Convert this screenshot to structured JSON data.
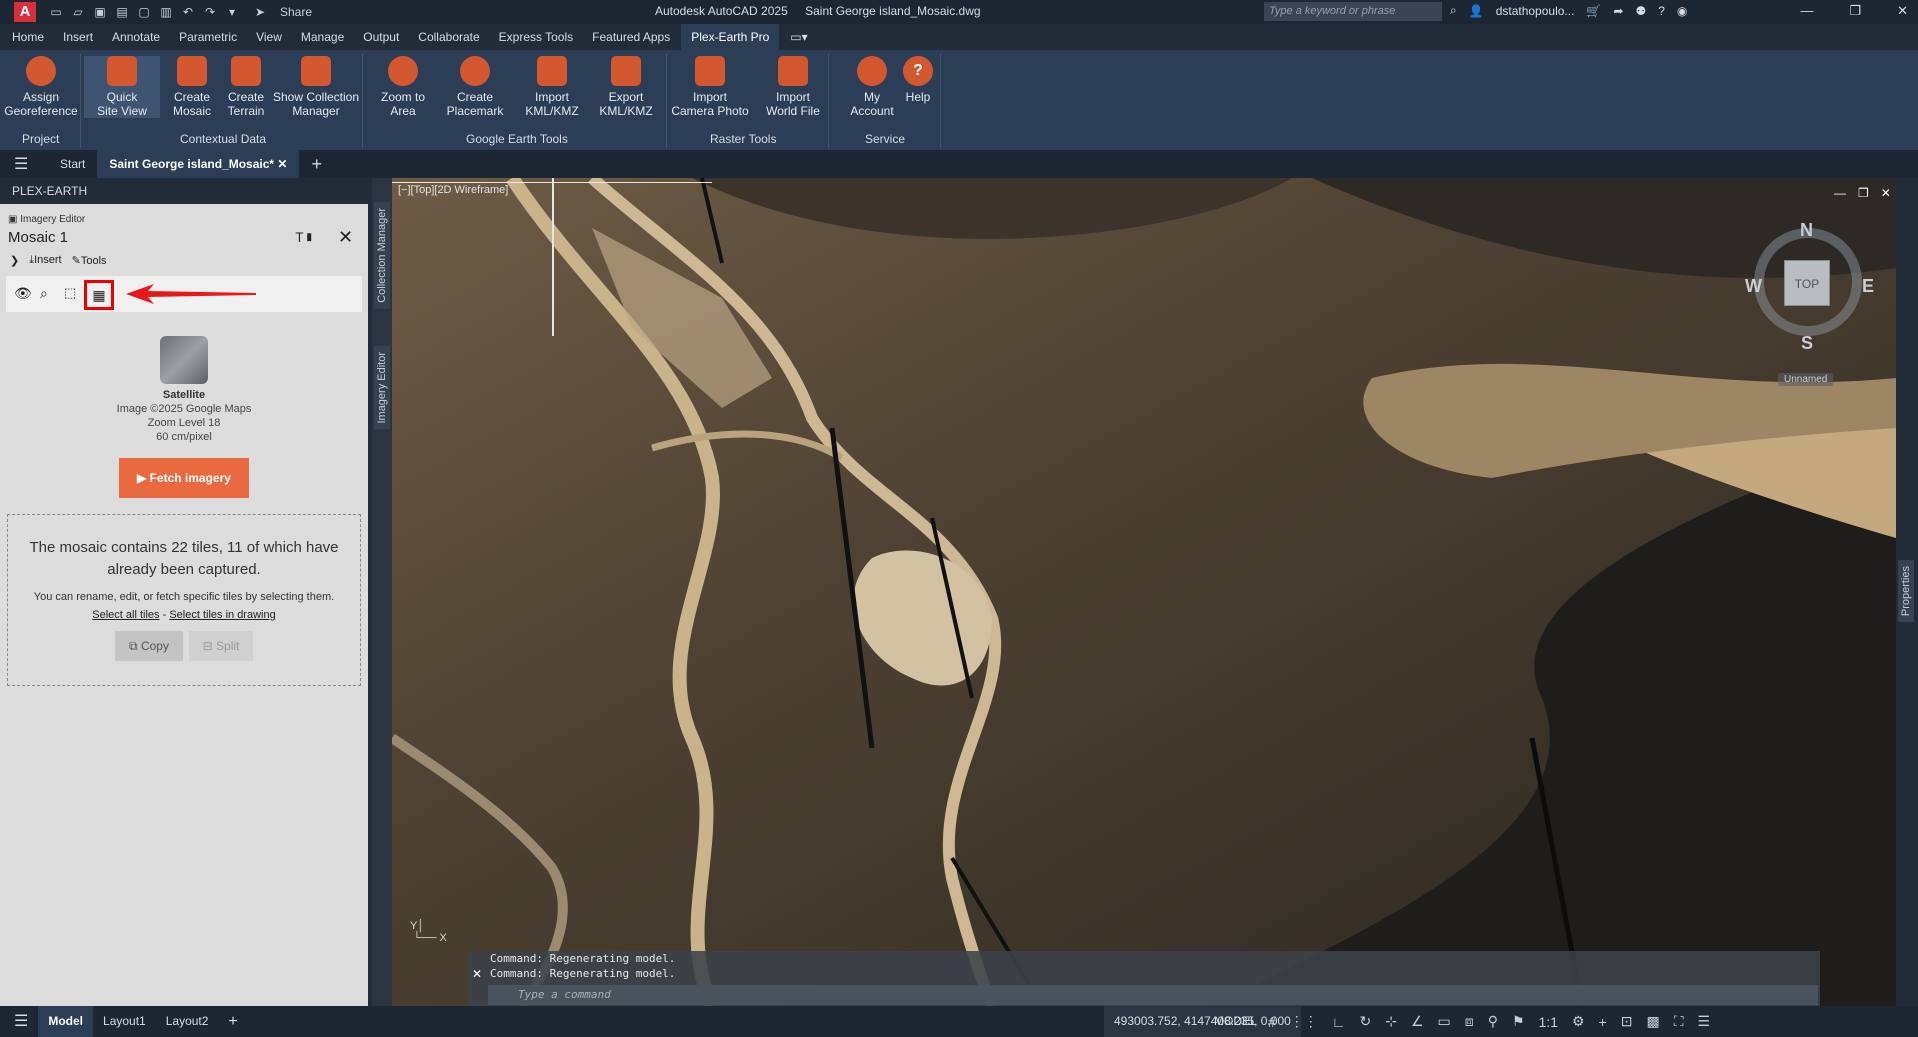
{
  "app": {
    "logo": "A",
    "share": "Share",
    "title": "Autodesk AutoCAD 2025",
    "filename": "Saint George island_Mosaic.dwg",
    "search_placeholder": "Type a keyword or phrase",
    "user": "dstathopoulo..."
  },
  "menu": [
    "Home",
    "Insert",
    "Annotate",
    "Parametric",
    "View",
    "Manage",
    "Output",
    "Collaborate",
    "Express Tools",
    "Featured Apps",
    "Plex-Earth Pro"
  ],
  "ribbon": {
    "buttons": [
      {
        "label1": "Assign",
        "label2": "Georeference",
        "icon": "georeference-icon"
      },
      {
        "label1": "Quick",
        "label2": "Site View",
        "icon": "site-view-icon"
      },
      {
        "label1": "Create",
        "label2": "Mosaic",
        "icon": "mosaic-icon"
      },
      {
        "label1": "Create",
        "label2": "Terrain",
        "icon": "terrain-icon"
      },
      {
        "label1": "Show Collection",
        "label2": "Manager",
        "icon": "collection-icon"
      },
      {
        "label1": "Zoom to",
        "label2": "Area",
        "icon": "zoom-area-icon"
      },
      {
        "label1": "Create",
        "label2": "Placemark",
        "icon": "placemark-icon"
      },
      {
        "label1": "Import",
        "label2": "KML/KMZ",
        "icon": "kml-import-icon"
      },
      {
        "label1": "Export",
        "label2": "KML/KMZ",
        "icon": "kml-export-icon"
      },
      {
        "label1": "Import",
        "label2": "Camera Photo",
        "icon": "camera-icon"
      },
      {
        "label1": "Import",
        "label2": "World File",
        "icon": "world-file-icon"
      },
      {
        "label1": "My",
        "label2": "Account",
        "icon": "account-icon"
      },
      {
        "label1": "Help",
        "label2": "",
        "icon": "help-icon"
      }
    ],
    "panels": [
      "Project",
      "Contextual Data",
      "Google Earth Tools",
      "Raster Tools",
      "Service"
    ]
  },
  "tabs": {
    "start": "Start",
    "current": "Saint George island_Mosaic*"
  },
  "palette": {
    "header": "PLEX-EARTH",
    "section": "Imagery Editor",
    "mosaic_name": "Mosaic 1",
    "insert": "Insert",
    "tools": "Tools",
    "imagery_type": "Satellite",
    "image_credit": "Image ©2025 Google Maps",
    "zoom_level": "Zoom Level 18",
    "resolution": "60 cm/pixel",
    "fetch": "Fetch imagery",
    "info_main": "The mosaic contains 22 tiles, 11 of which have already been captured.",
    "info_sub": "You can rename, edit, or fetch specific tiles by selecting them.",
    "select_all": "Select all tiles",
    "dash": "-",
    "select_drawing": "Select tiles in drawing",
    "copy": "Copy",
    "split": "Split"
  },
  "side_tabs": [
    "Collection Manager",
    "Imagery Editor"
  ],
  "viewport": {
    "label": "[−][Top][2D Wireframe]",
    "compass": {
      "n": "N",
      "s": "S",
      "e": "E",
      "w": "W",
      "top": "TOP"
    },
    "ucs": "Unnamed",
    "properties": "Properties"
  },
  "command": {
    "line1": "Command: Regenerating model.",
    "line2": "Command: Regenerating model.",
    "placeholder": "Type a command"
  },
  "status": {
    "layouts": [
      "Model",
      "Layout1",
      "Layout2"
    ],
    "coords": "493003.752, 4147408.235, 0.000",
    "mode": "MODEL",
    "scale": "1:1"
  }
}
